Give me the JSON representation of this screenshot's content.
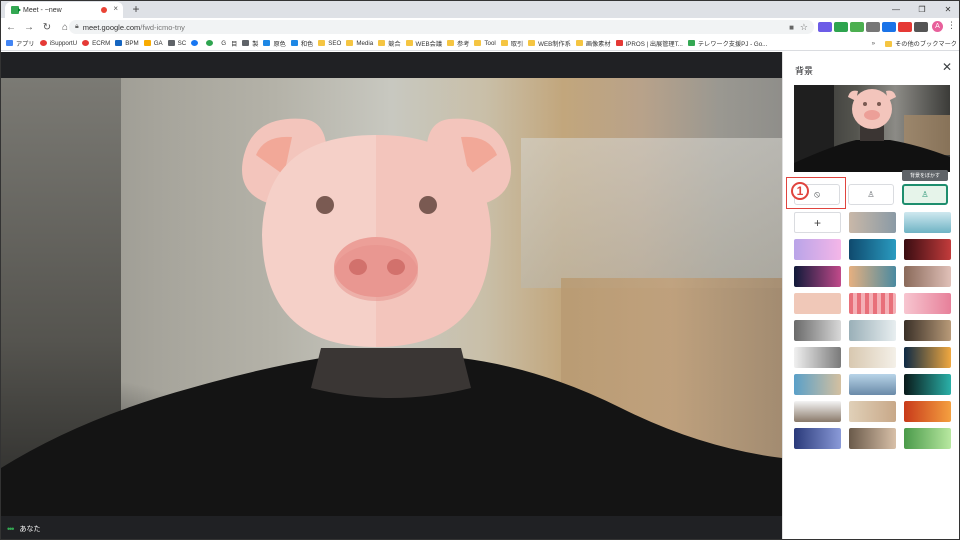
{
  "browser": {
    "tab_title": "Meet - ~new",
    "tab_close": "×",
    "new_tab": "+",
    "url_domain": "meet.google.com",
    "url_path": "/fwd-icmo-tny",
    "window_controls": [
      "—",
      "❐",
      "✕"
    ]
  },
  "bookmarks": {
    "items": [
      "アプリ",
      "iSupportU",
      "ECRM",
      "BPM",
      "GA",
      "SC",
      "G",
      "目",
      "製",
      "原色",
      "和色",
      "SEO",
      "Media",
      "競合",
      "WEB会議",
      "参考",
      "Tool",
      "取引",
      "WEB制作系",
      "画像素材",
      "IPROS | 出展管理T...",
      "テレワーク支援PJ - Go..."
    ],
    "overflow": "»",
    "other": "その他のブックマーク"
  },
  "account": {
    "initial": "A"
  },
  "meet": {
    "self_label": "あなた",
    "dots": "•••"
  },
  "panel": {
    "title": "背景",
    "close": "✕",
    "tooltip": "背景をぼかす",
    "add_label": "+",
    "annotation_number": "1"
  },
  "colors": {
    "accent": "#1e8e6e",
    "annotation": "#e0443e",
    "meet_bg": "#202124"
  }
}
